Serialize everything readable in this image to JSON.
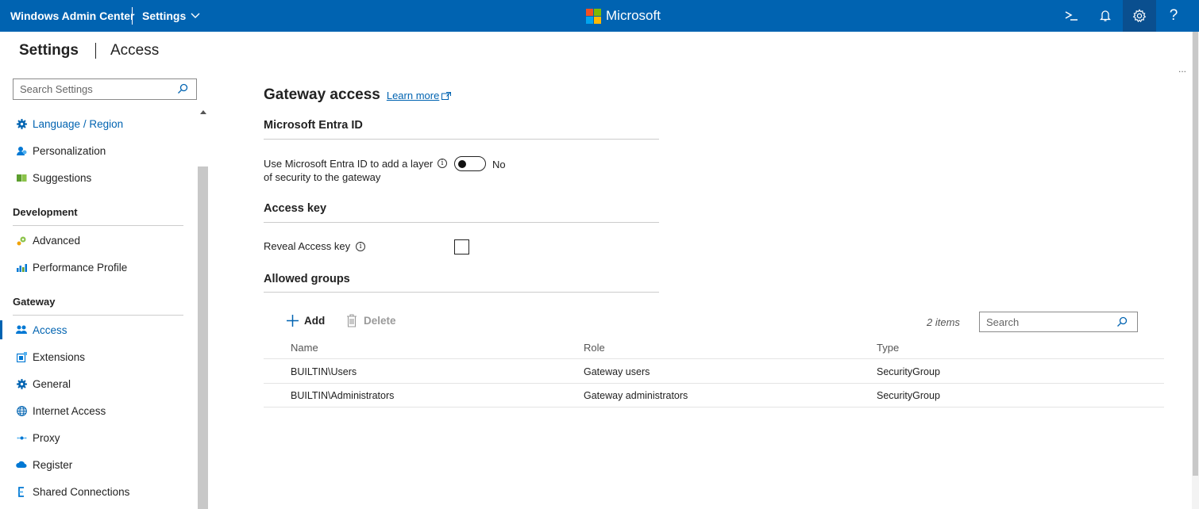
{
  "topbar": {
    "app_name": "Windows Admin Center",
    "context_menu": "Settings",
    "brand": "Microsoft",
    "icons": [
      "powershell-icon",
      "notifications-icon",
      "settings-gear-icon",
      "help-icon"
    ],
    "help_glyph": "?"
  },
  "page": {
    "title": "Settings",
    "subtitle": "Access",
    "ellipsis": "..."
  },
  "sidebar": {
    "search_placeholder": "Search Settings",
    "items_top": [
      {
        "label": "Language / Region",
        "icon": "gear-icon"
      },
      {
        "label": "Personalization",
        "icon": "personalization-icon"
      },
      {
        "label": "Suggestions",
        "icon": "suggestions-icon"
      }
    ],
    "group_development": "Development",
    "items_development": [
      {
        "label": "Advanced",
        "icon": "advanced-icon"
      },
      {
        "label": "Performance Profile",
        "icon": "performance-icon"
      }
    ],
    "group_gateway": "Gateway",
    "items_gateway": [
      {
        "label": "Access",
        "icon": "access-users-icon"
      },
      {
        "label": "Extensions",
        "icon": "extensions-icon"
      },
      {
        "label": "General",
        "icon": "gear-icon"
      },
      {
        "label": "Internet Access",
        "icon": "globe-icon"
      },
      {
        "label": "Proxy",
        "icon": "proxy-icon"
      },
      {
        "label": "Register",
        "icon": "cloud-icon"
      },
      {
        "label": "Shared Connections",
        "icon": "shared-connections-icon"
      }
    ]
  },
  "main": {
    "heading": "Gateway access",
    "learn_more": "Learn more",
    "entra": {
      "heading": "Microsoft Entra ID",
      "description": "Use Microsoft Entra ID to add a layer of security to the gateway",
      "toggle_state": "No",
      "toggle_on": false
    },
    "access_key": {
      "heading": "Access key",
      "reveal_label": "Reveal Access key",
      "checked": false
    },
    "allowed_groups": {
      "heading": "Allowed groups",
      "add_label": "Add",
      "delete_label": "Delete",
      "items_count": "2 items",
      "search_placeholder": "Search",
      "columns": [
        "Name",
        "Role",
        "Type"
      ],
      "rows": [
        {
          "name": "BUILTIN\\Users",
          "role": "Gateway users",
          "type": "SecurityGroup"
        },
        {
          "name": "BUILTIN\\Administrators",
          "role": "Gateway administrators",
          "type": "SecurityGroup"
        }
      ]
    }
  },
  "colors": {
    "topbar": "#0063b1",
    "accent": "#0063b1"
  }
}
